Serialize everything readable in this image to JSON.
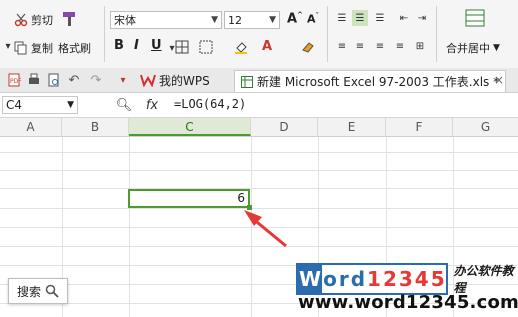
{
  "ribbon": {
    "cut_label": "剪切",
    "copy_label": "复制",
    "format_painter_label": "格式刷",
    "font_name": "宋体",
    "font_size": "12",
    "grow_font": "A",
    "shrink_font": "A",
    "bold": "B",
    "italic": "I",
    "underline": "U",
    "merge_center_label": "合并居中"
  },
  "tabs": {
    "wps_label": "我的WPS",
    "excel_label": "新建 Microsoft Excel 97-2003 工作表.xls *"
  },
  "formula_bar": {
    "name_box": "C4",
    "fx": "fx",
    "formula": "=LOG(64,2)"
  },
  "grid": {
    "columns": [
      "A",
      "B",
      "C",
      "D",
      "E",
      "F",
      "G"
    ],
    "active_column": "C",
    "active_cell_value": "6"
  },
  "search": {
    "label": "搜索"
  },
  "watermark": {
    "brand_chars": [
      "W",
      "o",
      "r",
      "d",
      "1",
      "2",
      "3",
      "4",
      "5"
    ],
    "subtitle": "办公软件教程",
    "url": "www.word12345.com"
  },
  "colors": {
    "accent_green": "#4f9a2e",
    "arrow_red": "#e53935",
    "brand_blue": "#2b6cb0"
  }
}
